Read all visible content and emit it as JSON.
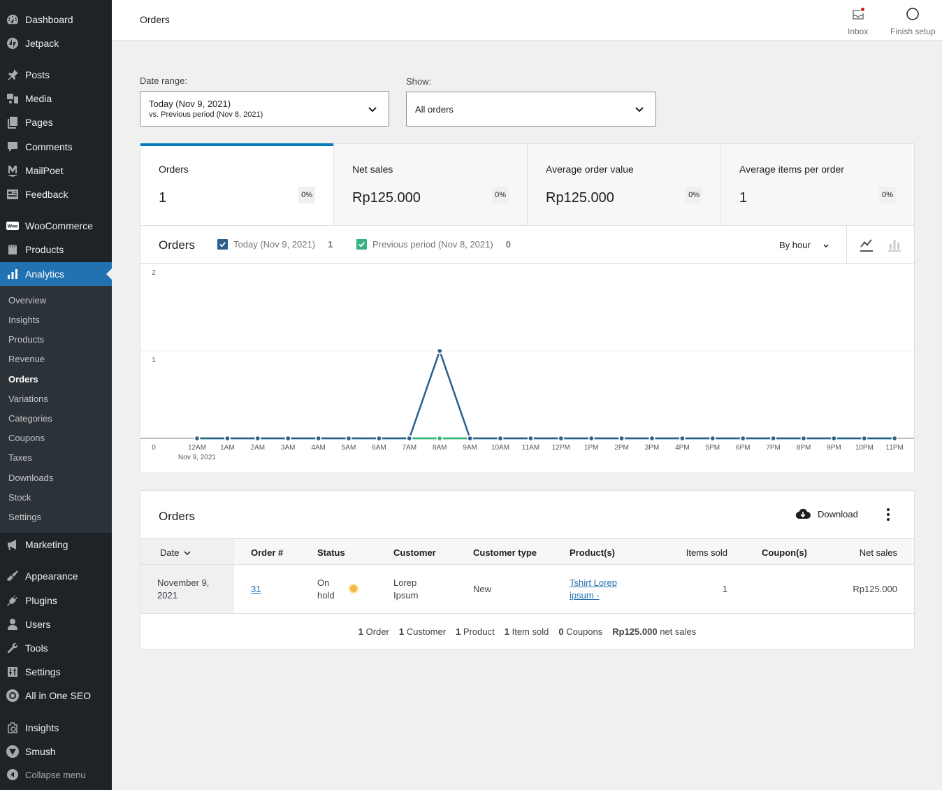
{
  "sidebar": {
    "items": [
      {
        "id": "dashboard",
        "label": "Dashboard",
        "icon": "dashboard-icon"
      },
      {
        "id": "jetpack",
        "label": "Jetpack",
        "icon": "jetpack-icon"
      },
      {
        "id": "posts",
        "label": "Posts",
        "icon": "pin-icon"
      },
      {
        "id": "media",
        "label": "Media",
        "icon": "media-icon"
      },
      {
        "id": "pages",
        "label": "Pages",
        "icon": "pages-icon"
      },
      {
        "id": "comments",
        "label": "Comments",
        "icon": "comment-icon"
      },
      {
        "id": "mailpoet",
        "label": "MailPoet",
        "icon": "mailpoet-icon"
      },
      {
        "id": "feedback",
        "label": "Feedback",
        "icon": "feedback-icon"
      },
      {
        "id": "woocommerce",
        "label": "WooCommerce",
        "icon": "woo-icon"
      },
      {
        "id": "products",
        "label": "Products",
        "icon": "products-icon"
      },
      {
        "id": "analytics",
        "label": "Analytics",
        "icon": "bar-chart-icon",
        "active": true
      },
      {
        "id": "marketing",
        "label": "Marketing",
        "icon": "megaphone-icon"
      },
      {
        "id": "appearance",
        "label": "Appearance",
        "icon": "brush-icon"
      },
      {
        "id": "plugins",
        "label": "Plugins",
        "icon": "plug-icon"
      },
      {
        "id": "users",
        "label": "Users",
        "icon": "user-icon"
      },
      {
        "id": "tools",
        "label": "Tools",
        "icon": "wrench-icon"
      },
      {
        "id": "settings",
        "label": "Settings",
        "icon": "sliders-icon"
      },
      {
        "id": "aioseo",
        "label": "All in One SEO",
        "icon": "aioseo-icon"
      },
      {
        "id": "insights",
        "label": "Insights",
        "icon": "insights-icon"
      },
      {
        "id": "smush",
        "label": "Smush",
        "icon": "smush-icon"
      }
    ],
    "submenu": [
      "Overview",
      "Insights",
      "Products",
      "Revenue",
      "Orders",
      "Variations",
      "Categories",
      "Coupons",
      "Taxes",
      "Downloads",
      "Stock",
      "Settings"
    ],
    "submenu_current": "Orders",
    "collapse_label": "Collapse menu"
  },
  "header": {
    "title": "Orders",
    "inbox_label": "Inbox",
    "finish_setup_label": "Finish setup"
  },
  "filters": {
    "date_range_label": "Date range:",
    "date_range_primary": "Today (Nov 9, 2021)",
    "date_range_secondary": "vs. Previous period (Nov 8, 2021)",
    "show_label": "Show:",
    "show_value": "All orders"
  },
  "summary": [
    {
      "label": "Orders",
      "value": "1",
      "delta": "0%",
      "selected": true
    },
    {
      "label": "Net sales",
      "value": "Rp125.000",
      "delta": "0%"
    },
    {
      "label": "Average order value",
      "value": "Rp125.000",
      "delta": "0%"
    },
    {
      "label": "Average items per order",
      "value": "1",
      "delta": "0%"
    }
  ],
  "chart_panel": {
    "title": "Orders",
    "legend": [
      {
        "label": "Today (Nov 9, 2021)",
        "total": "1",
        "color": "#2b5f8a"
      },
      {
        "label": "Previous period (Nov 8, 2021)",
        "total": "0",
        "color": "#36b37e"
      }
    ],
    "interval": "By hour"
  },
  "chart_data": {
    "type": "line",
    "title": "Orders",
    "x": [
      "12AM",
      "1AM",
      "2AM",
      "3AM",
      "4AM",
      "5AM",
      "6AM",
      "7AM",
      "8AM",
      "9AM",
      "10AM",
      "11AM",
      "12PM",
      "1PM",
      "2PM",
      "3PM",
      "4PM",
      "5PM",
      "6PM",
      "7PM",
      "8PM",
      "9PM",
      "10PM",
      "11PM"
    ],
    "x_sublabel": "Nov 9, 2021",
    "series": [
      {
        "name": "Today (Nov 9, 2021)",
        "color": "#2b5f8a",
        "values": [
          0,
          0,
          0,
          0,
          0,
          0,
          0,
          0,
          1,
          0,
          0,
          0,
          0,
          0,
          0,
          0,
          0,
          0,
          0,
          0,
          0,
          0,
          0,
          0
        ]
      },
      {
        "name": "Previous period (Nov 8, 2021)",
        "color": "#36b37e",
        "values": [
          0,
          0,
          0,
          0,
          0,
          0,
          0,
          0,
          0,
          0,
          0,
          0,
          0,
          0,
          0,
          0,
          0,
          0,
          0,
          0,
          0,
          0,
          0,
          0
        ]
      }
    ],
    "yticks": [
      0,
      1,
      2
    ],
    "ylim": [
      0,
      2
    ],
    "grid": true,
    "xlabel": "",
    "ylabel": ""
  },
  "table": {
    "title": "Orders",
    "download_label": "Download",
    "columns": [
      "Date",
      "Order #",
      "Status",
      "Customer",
      "Customer type",
      "Product(s)",
      "Items sold",
      "Coupon(s)",
      "Net sales"
    ],
    "rows": [
      {
        "date_line1": "November 9,",
        "date_line2": "2021",
        "order": "31",
        "status_line1": "On",
        "status_line2": "hold",
        "customer_line1": "Lorep",
        "customer_line2": "Ipsum",
        "customer_type": "New",
        "product_line1": "Tshirt Lorep",
        "product_line2": "ipsum -",
        "items_sold": "1",
        "coupons": "",
        "net_sales": "Rp125.000"
      }
    ],
    "footer": [
      {
        "count": "1",
        "label": "Order"
      },
      {
        "count": "1",
        "label": "Customer"
      },
      {
        "count": "1",
        "label": "Product"
      },
      {
        "count": "1",
        "label": "Item sold"
      },
      {
        "count": "0",
        "label": "Coupons"
      },
      {
        "count": "Rp125.000",
        "label": "net sales"
      }
    ]
  },
  "colors": {
    "accent": "#007cba",
    "sidebar_bg": "#1d2327",
    "sidebar_active": "#2271b1",
    "status_on_hold": "#f0b849"
  }
}
